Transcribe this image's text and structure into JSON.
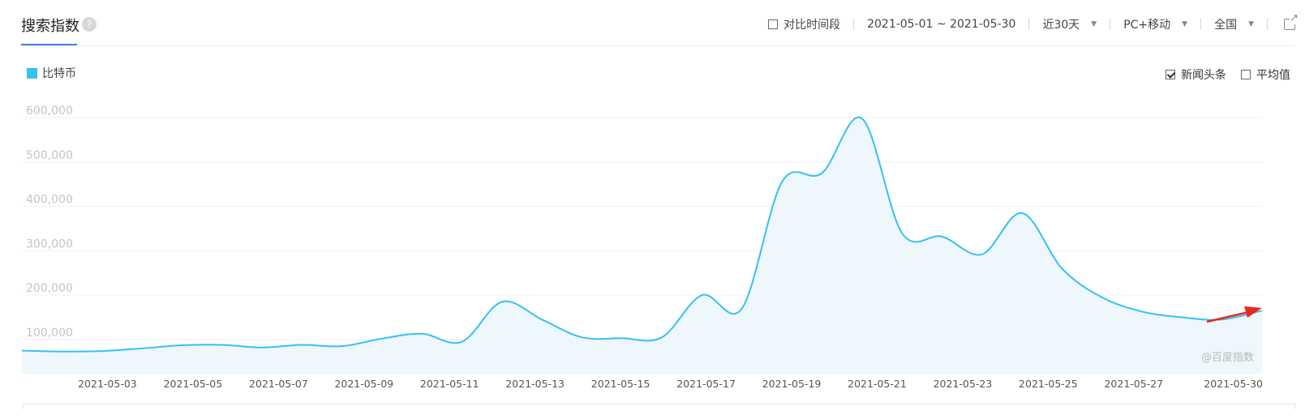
{
  "header": {
    "title": "搜索指数",
    "help_icon": "?",
    "toolbar": {
      "compare_label": "对比时间段",
      "date_range": "2021-05-01 ~ 2021-05-30",
      "period": "近30天",
      "device": "PC+移动",
      "region": "全国",
      "export_icon": "external-link-icon"
    }
  },
  "options": {
    "news_label": "新闻头条",
    "news_checked": true,
    "avg_label": "平均值",
    "avg_checked": false
  },
  "watermark": "@百度指数",
  "colors": {
    "series": "#35c1f1",
    "fill": "#eef7fb",
    "accent": "#3d7ff0",
    "arrow": "#e8291c"
  },
  "chart_data": {
    "type": "area",
    "x": [
      "2021-05-01",
      "2021-05-02",
      "2021-05-03",
      "2021-05-04",
      "2021-05-05",
      "2021-05-06",
      "2021-05-07",
      "2021-05-08",
      "2021-05-09",
      "2021-05-10",
      "2021-05-11",
      "2021-05-12",
      "2021-05-13",
      "2021-05-14",
      "2021-05-15",
      "2021-05-16",
      "2021-05-17",
      "2021-05-18",
      "2021-05-19",
      "2021-05-20",
      "2021-05-21",
      "2021-05-22",
      "2021-05-23",
      "2021-05-24",
      "2021-05-25",
      "2021-05-26",
      "2021-05-27",
      "2021-05-28",
      "2021-05-29",
      "2021-05-30"
    ],
    "xticks": [
      "2021-05-03",
      "2021-05-05",
      "2021-05-07",
      "2021-05-09",
      "2021-05-11",
      "2021-05-13",
      "2021-05-15",
      "2021-05-17",
      "2021-05-19",
      "2021-05-21",
      "2021-05-23",
      "2021-05-25",
      "2021-05-27",
      "2021-05-30"
    ],
    "yticks": [
      "100,000",
      "200,000",
      "300,000",
      "400,000",
      "500,000",
      "600,000"
    ],
    "ytick_values": [
      100000,
      200000,
      300000,
      400000,
      500000,
      600000
    ],
    "ylim": [
      25000,
      655000
    ],
    "series": [
      {
        "name": "比特币",
        "values": [
          75000,
          73000,
          74000,
          80000,
          87000,
          88000,
          82000,
          88000,
          85000,
          102000,
          113000,
          95000,
          185000,
          145000,
          105000,
          103000,
          105000,
          200000,
          170000,
          455000,
          475000,
          598000,
          340000,
          332000,
          292000,
          385000,
          260000,
          195000,
          163000,
          150000,
          145000,
          165000
        ]
      }
    ],
    "legend_position": "top-left",
    "grid": true
  }
}
